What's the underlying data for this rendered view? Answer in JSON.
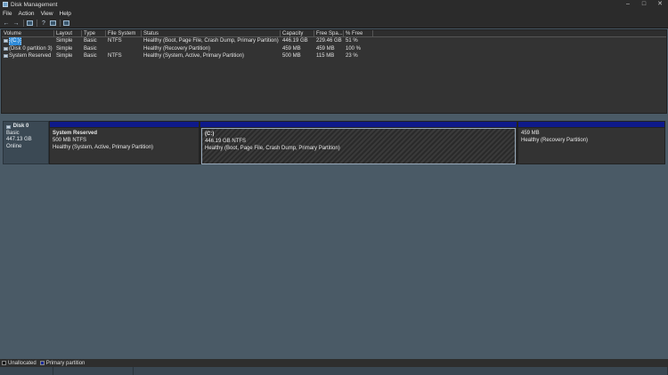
{
  "window": {
    "title": "Disk Management",
    "controls": [
      "–",
      "□",
      "✕"
    ]
  },
  "menu": [
    "File",
    "Action",
    "View",
    "Help"
  ],
  "toolbar": [
    "back-icon",
    "forward-icon",
    "folder-icon",
    "help-icon",
    "properties-icon",
    "console-icon"
  ],
  "volumes": {
    "columns": [
      "Volume",
      "Layout",
      "Type",
      "File System",
      "Status",
      "Capacity",
      "Free Spa...",
      "% Free"
    ],
    "rows": [
      [
        "(C:)",
        "Simple",
        "Basic",
        "NTFS",
        "Healthy (Boot, Page File, Crash Dump, Primary Partition)",
        "446.19 GB",
        "229.46 GB",
        "51 %"
      ],
      [
        "(Disk 0 partition 3)",
        "Simple",
        "Basic",
        "",
        "Healthy (Recovery Partition)",
        "459 MB",
        "459 MB",
        "100 %"
      ],
      [
        "System Reserved",
        "Simple",
        "Basic",
        "NTFS",
        "Healthy (System, Active, Primary Partition)",
        "500 MB",
        "115 MB",
        "23 %"
      ]
    ]
  },
  "disk": {
    "name": "Disk 0",
    "type": "Basic",
    "size": "447.13 GB",
    "state": "Online",
    "partitions": [
      {
        "name": "System Reserved",
        "size": "500 MB NTFS",
        "status": "Healthy (System, Active, Primary Partition)"
      },
      {
        "name": "(C:)",
        "size": "446.19 GB NTFS",
        "status": "Healthy (Boot, Page File, Crash Dump, Primary Partition)"
      },
      {
        "name": "",
        "size": "459 MB",
        "status": "Healthy (Recovery Partition)"
      }
    ]
  },
  "legend": {
    "unallocated": "Unallocated",
    "primary": "Primary partition"
  },
  "colors": {
    "primary_bar": "#0f1a8a",
    "selection": "#2f8bd8",
    "pane_bg": "#4a5a66"
  }
}
